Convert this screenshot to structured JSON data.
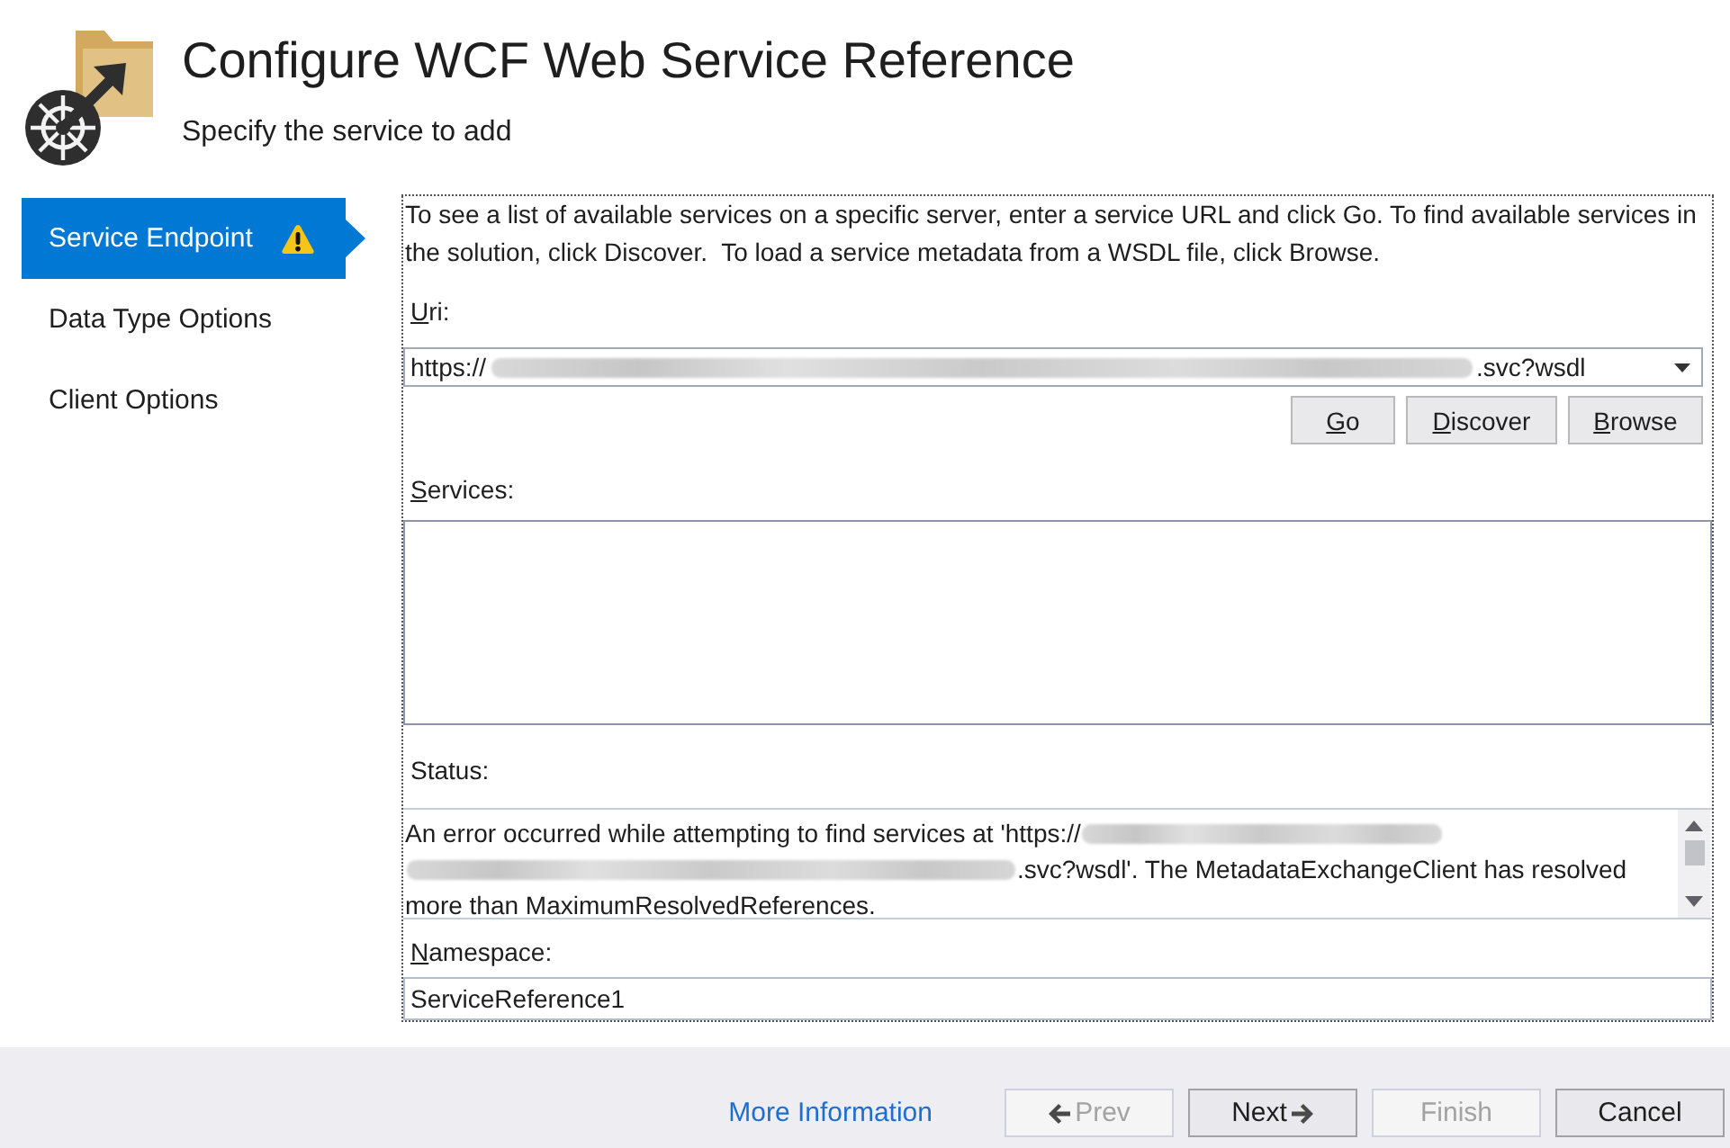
{
  "header": {
    "title": "Configure WCF Web Service Reference",
    "subtitle": "Specify the service to add"
  },
  "sidebar": {
    "items": [
      {
        "label": "Service Endpoint",
        "selected": true,
        "warning": true
      },
      {
        "label": "Data Type Options",
        "selected": false,
        "warning": false
      },
      {
        "label": "Client Options",
        "selected": false,
        "warning": false
      }
    ]
  },
  "endpoint": {
    "description": "To see a list of available services on a specific server, enter a service URL and click Go. To find available services in the solution, click Discover.  To load a service metadata from a WSDL file, click Browse.",
    "uri": {
      "label": "Uri:",
      "mnemonic": true,
      "value": [
        {
          "kind": "text",
          "text": "https://"
        },
        {
          "kind": "redacted"
        },
        {
          "kind": "text",
          "text": ".svc?wsdl"
        }
      ]
    },
    "buttons": [
      {
        "label": "Go",
        "mnemonic": true
      },
      {
        "label": "Discover",
        "mnemonic": true
      },
      {
        "label": "Browse",
        "mnemonic": true
      }
    ],
    "services": {
      "label": "Services:",
      "mnemonic": true
    },
    "status": {
      "label": "Status:",
      "mnemonic": false,
      "lines": [
        {
          "segments": [
            {
              "kind": "text",
              "text": "An error occurred while attempting to find services at 'https://"
            },
            {
              "kind": "redacted"
            }
          ]
        },
        {
          "segments": [
            {
              "kind": "redacted"
            },
            {
              "kind": "text",
              "text": ".svc?wsdl'. The MetadataExchangeClient has resolved"
            }
          ]
        },
        {
          "segments": [
            {
              "kind": "text",
              "text": "more than MaximumResolvedReferences."
            }
          ]
        }
      ]
    },
    "namespace": {
      "label": "Namespace:",
      "mnemonic": true,
      "value": "ServiceReference1"
    }
  },
  "footer": {
    "link": "More Information",
    "buttons": [
      {
        "label": "Prev",
        "kind": "back",
        "disabled": true
      },
      {
        "label": "Next",
        "kind": "forward",
        "disabled": false
      },
      {
        "label": "Finish",
        "kind": "plain",
        "disabled": true
      },
      {
        "label": "Cancel",
        "kind": "plain",
        "disabled": false
      }
    ]
  }
}
